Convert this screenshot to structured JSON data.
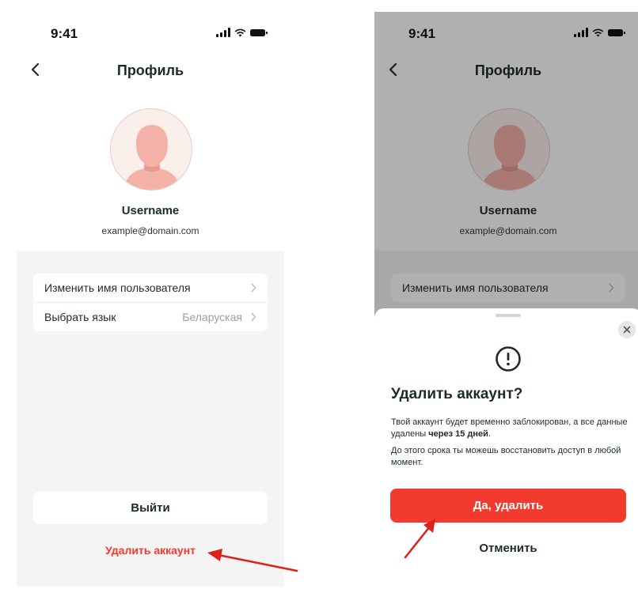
{
  "colors": {
    "accent_red": "#f23a2e",
    "text_dark": "#1f2a2c",
    "background_gray": "#f4f4f4",
    "annotation_arrow": "#e0201a"
  },
  "left_screen": {
    "status_time": "9:41",
    "title": "Профиль",
    "username": "Username",
    "email": "example@domain.com",
    "settings": [
      {
        "label": "Изменить имя пользователя",
        "value": ""
      },
      {
        "label": "Выбрать язык",
        "value": "Беларуская"
      }
    ],
    "logout_label": "Выйти",
    "delete_label": "Удалить аккаунт"
  },
  "right_screen": {
    "status_time": "9:41",
    "title": "Профиль",
    "username": "Username",
    "email": "example@domain.com",
    "settings": [
      {
        "label": "Изменить имя пользователя"
      }
    ],
    "sheet": {
      "title": "Удалить аккаунт?",
      "text1_prefix": "Твой аккаунт будет временно заблокирован, а все данные удалены ",
      "text1_bold": "через 15 дней",
      "text1_suffix": ".",
      "text2": "До этого срока ты можешь восстановить доступ в любой момент.",
      "confirm_label": "Да, удалить",
      "cancel_label": "Отменить"
    }
  },
  "icons": [
    "back-icon",
    "signal-icon",
    "wifi-icon",
    "battery-icon",
    "avatar-placeholder-icon",
    "chevron-right-icon",
    "close-icon",
    "alert-icon",
    "annotation-arrow-icon"
  ]
}
